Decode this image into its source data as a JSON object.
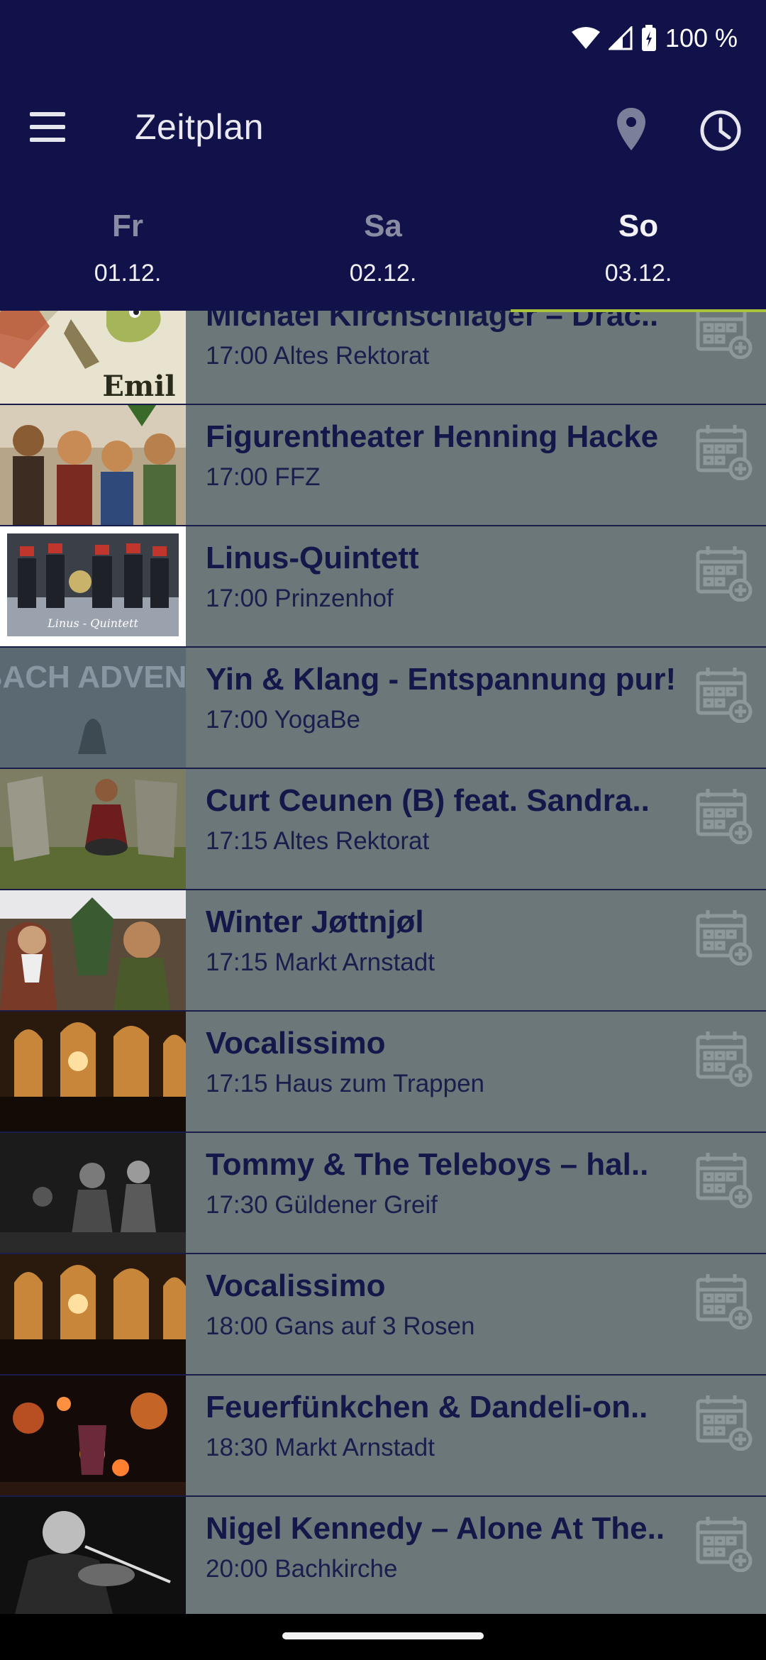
{
  "status": {
    "battery": "100 %"
  },
  "toolbar": {
    "title": "Zeitplan"
  },
  "days": [
    {
      "name": "Fr",
      "date": "01.12."
    },
    {
      "name": "Sa",
      "date": "02.12."
    },
    {
      "name": "So",
      "date": "03.12."
    }
  ],
  "events": [
    {
      "title": "Michael Kirchschlager – Drac..",
      "subtitle": "17:00 Altes Rektorat",
      "thumb_text": "Emil"
    },
    {
      "title": "Figurentheater Henning Hacke",
      "subtitle": "17:00 FFZ"
    },
    {
      "title": "Linus-Quintett",
      "subtitle": "17:00 Prinzenhof",
      "thumb_text": "Linus - Quintett"
    },
    {
      "title": "Yin & Klang - Entspannung pur!",
      "subtitle": "17:00 YogaBe",
      "thumb_text": "BACH ADVENT"
    },
    {
      "title": "Curt Ceunen (B) feat. Sandra..",
      "subtitle": "17:15 Altes Rektorat"
    },
    {
      "title": "Winter Jøttnjøl",
      "subtitle": "17:15 Markt Arnstadt"
    },
    {
      "title": "Vocalissimo",
      "subtitle": "17:15 Haus zum Trappen"
    },
    {
      "title": "Tommy & The Teleboys – hal..",
      "subtitle": "17:30 Güldener Greif"
    },
    {
      "title": "Vocalissimo",
      "subtitle": "18:00 Gans auf 3 Rosen"
    },
    {
      "title": "Feuerfünkchen & Dandeli-on..",
      "subtitle": "18:30 Markt Arnstadt"
    },
    {
      "title": "Nigel Kennedy – Alone At The..",
      "subtitle": "20:00 Bachkirche"
    }
  ],
  "colors": {
    "header": "#11124a",
    "list_background": "#6c7779",
    "tab_indicator": "#a9c33a",
    "text_dark": "#15174a"
  },
  "icons": [
    "menu-icon",
    "location-pin-icon",
    "clock-icon",
    "calendar-add-icon",
    "wifi-icon",
    "signal-icon",
    "battery-icon"
  ]
}
